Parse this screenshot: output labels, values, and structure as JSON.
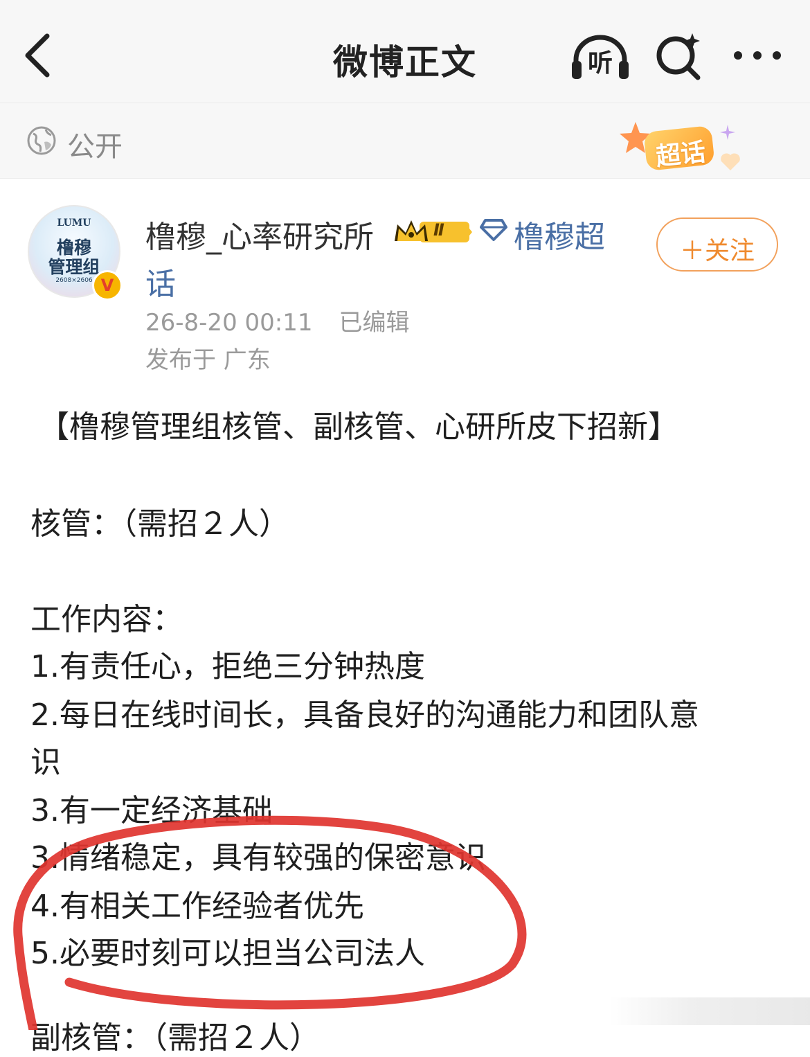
{
  "nav": {
    "title": "微博正文",
    "listen_label": "听",
    "icons": [
      "back-arrow-icon",
      "listen-headphones-icon",
      "search-sparkle-icon",
      "more-dots-icon"
    ]
  },
  "visibility": {
    "label": "公开",
    "icon": "globe-icon"
  },
  "chaohua_badge": {
    "label": "超话"
  },
  "author": {
    "name": "橹穆_心率研究所",
    "level": "Ⅱ",
    "tag_line1": "橹穆超",
    "tag_line2": "话",
    "avatar": {
      "line1": "LUMU",
      "line2": "橹穆",
      "line3": "管理组",
      "line4": "2608×2606"
    },
    "verified_mark": "V",
    "timestamp": "26-8-20 00:11",
    "edited": "已编辑",
    "location": "发布于 广东",
    "follow_label": "＋关注"
  },
  "post": {
    "headline": "【橹穆管理组核管、副核管、心研所皮下招新】",
    "section1_title": "核管：（需招２人）",
    "work_title": "工作内容：",
    "items": [
      "1.有责任心，拒绝三分钟热度",
      "2.每日在线时间长，具备良好的沟通能力和团队意",
      "识",
      "3.有一定经济基础",
      "3.情绪稳定，具有较强的保密意识",
      "4.有相关工作经验者优先",
      "5.必要时刻可以担当公司法人"
    ],
    "next_partial": "副核管：（需招２人）"
  },
  "colors": {
    "accent_orange": "#ef8a2e",
    "link_blue": "#4a6fa5",
    "annotation_red": "#e0342f",
    "muted_gray": "#9a9a9a"
  }
}
